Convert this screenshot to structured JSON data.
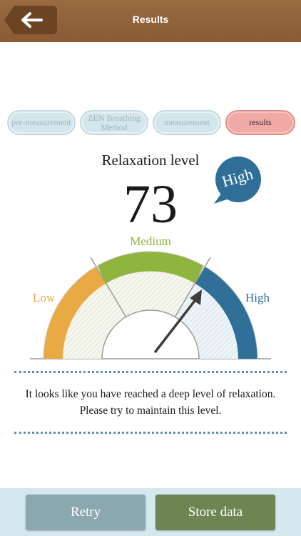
{
  "header": {
    "title": "Results",
    "back_icon": "arrow-left-icon"
  },
  "steps": [
    {
      "label": "pre-measurement",
      "active": false
    },
    {
      "label": "ZEN Breathing Method",
      "active": false
    },
    {
      "label": "measurement",
      "active": false
    },
    {
      "label": "results",
      "active": true
    }
  ],
  "result": {
    "title": "Relaxation level",
    "score": "73",
    "badge": "High"
  },
  "gauge": {
    "labels": {
      "low": "Low",
      "medium": "Medium",
      "high": "High"
    },
    "needle_level": 0.73,
    "colors": {
      "low": "#e9aa44",
      "medium": "#8fb53f",
      "high": "#2f6f98"
    }
  },
  "message": {
    "line1": "It looks like you have reached a deep level of relaxation.",
    "line2": "Please try to maintain this level."
  },
  "footer": {
    "retry_label": "Retry",
    "store_label": "Store data"
  }
}
